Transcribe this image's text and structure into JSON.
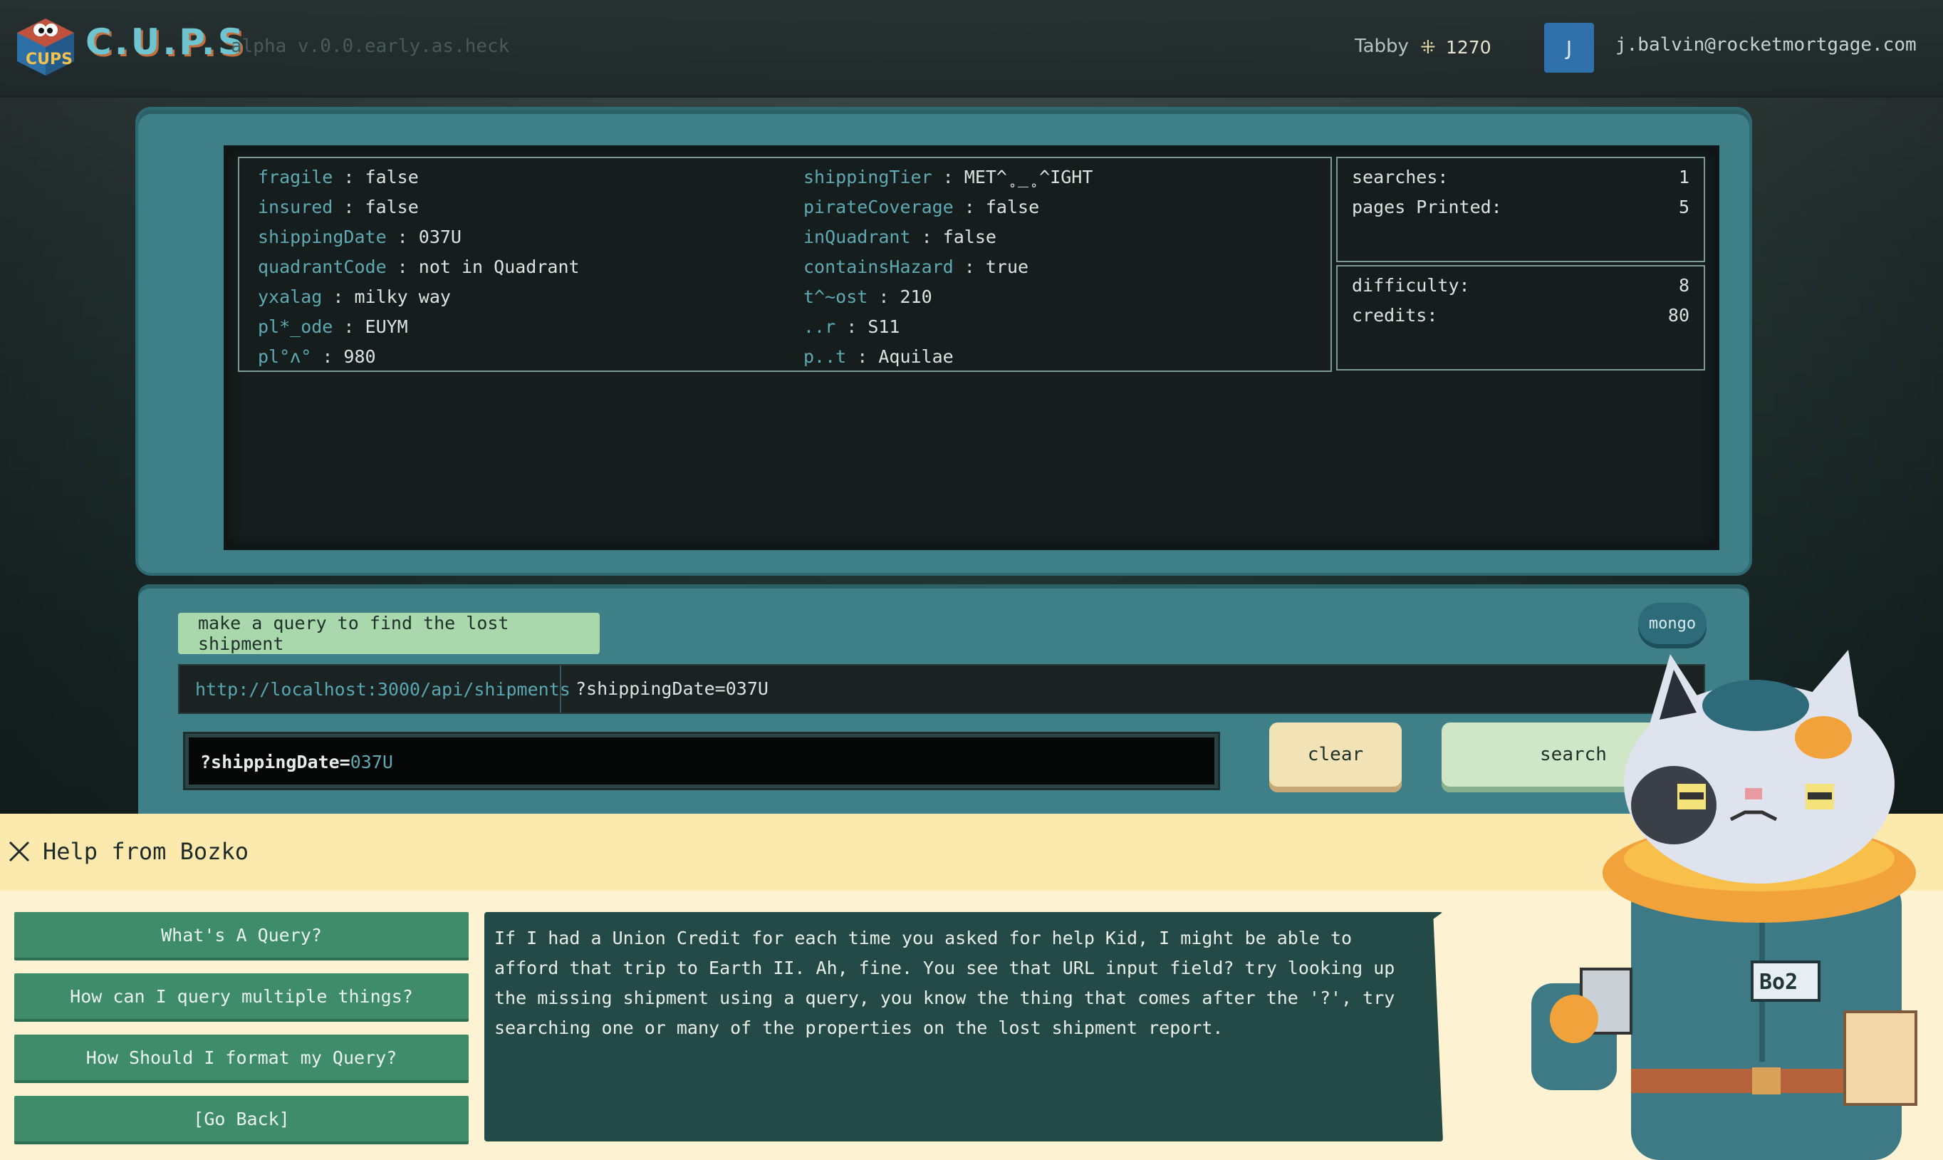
{
  "header": {
    "app_name": "C.U.P.S",
    "version": "alpha v.0.0.early.as.heck",
    "username": "Tabby",
    "credits_icon": "coin-icon",
    "credits": "1270",
    "avatar_initial": "J",
    "email": "j.balvin@rocketmortgage.com"
  },
  "report": {
    "left": [
      {
        "key": "fragile",
        "value": "false"
      },
      {
        "key": "insured",
        "value": "false"
      },
      {
        "key": "shippingDate",
        "value": "037U"
      },
      {
        "key": "quadrantCode",
        "value": "not in Quadrant"
      },
      {
        "key": "yxalag",
        "value": "milky way"
      },
      {
        "key": "pl*_ode",
        "value": "EUYM"
      },
      {
        "key": "pl°ʌ°",
        "value": "980"
      }
    ],
    "right": [
      {
        "key": "shippingTier",
        "value": "MET^˳_˳^IGHT"
      },
      {
        "key": "pirateCoverage",
        "value": "false"
      },
      {
        "key": "inQuadrant",
        "value": "false"
      },
      {
        "key": "containsHazard",
        "value": "true"
      },
      {
        "key": "t^~ost",
        "value": "210"
      },
      {
        "key": "..r",
        "value": "S11"
      },
      {
        "key": "p..t",
        "value": "Aquilae"
      }
    ]
  },
  "stats": {
    "searches_label": "searches:",
    "searches": "1",
    "pages_label": "pages Printed:",
    "pages": "5",
    "difficulty_label": "difficulty:",
    "difficulty": "8",
    "credits_label": "credits:",
    "credits": "80"
  },
  "console": {
    "task": "make a query to find the lost shipment",
    "mode": "mongo",
    "url_base": "http://localhost:3000/api/shipments",
    "url_query": "?shippingDate=037U",
    "input_key": "?shippingDate=",
    "input_value": "037U",
    "clear_label": "clear",
    "search_label": "search"
  },
  "help": {
    "title": "Help from Bozko",
    "buttons": [
      "What's A Query?",
      "How can I query multiple things?",
      "How Should I format my Query?",
      "[Go Back]"
    ],
    "message": "If I had a Union Credit for each time you asked for help Kid, I might be able to afford that trip to Earth II. Ah, fine. You see that URL input field? try looking up the missing shipment using a query, you know the thing that comes after the '?', try searching one or many of the properties on the lost shipment report.",
    "badge": "Bo2"
  }
}
